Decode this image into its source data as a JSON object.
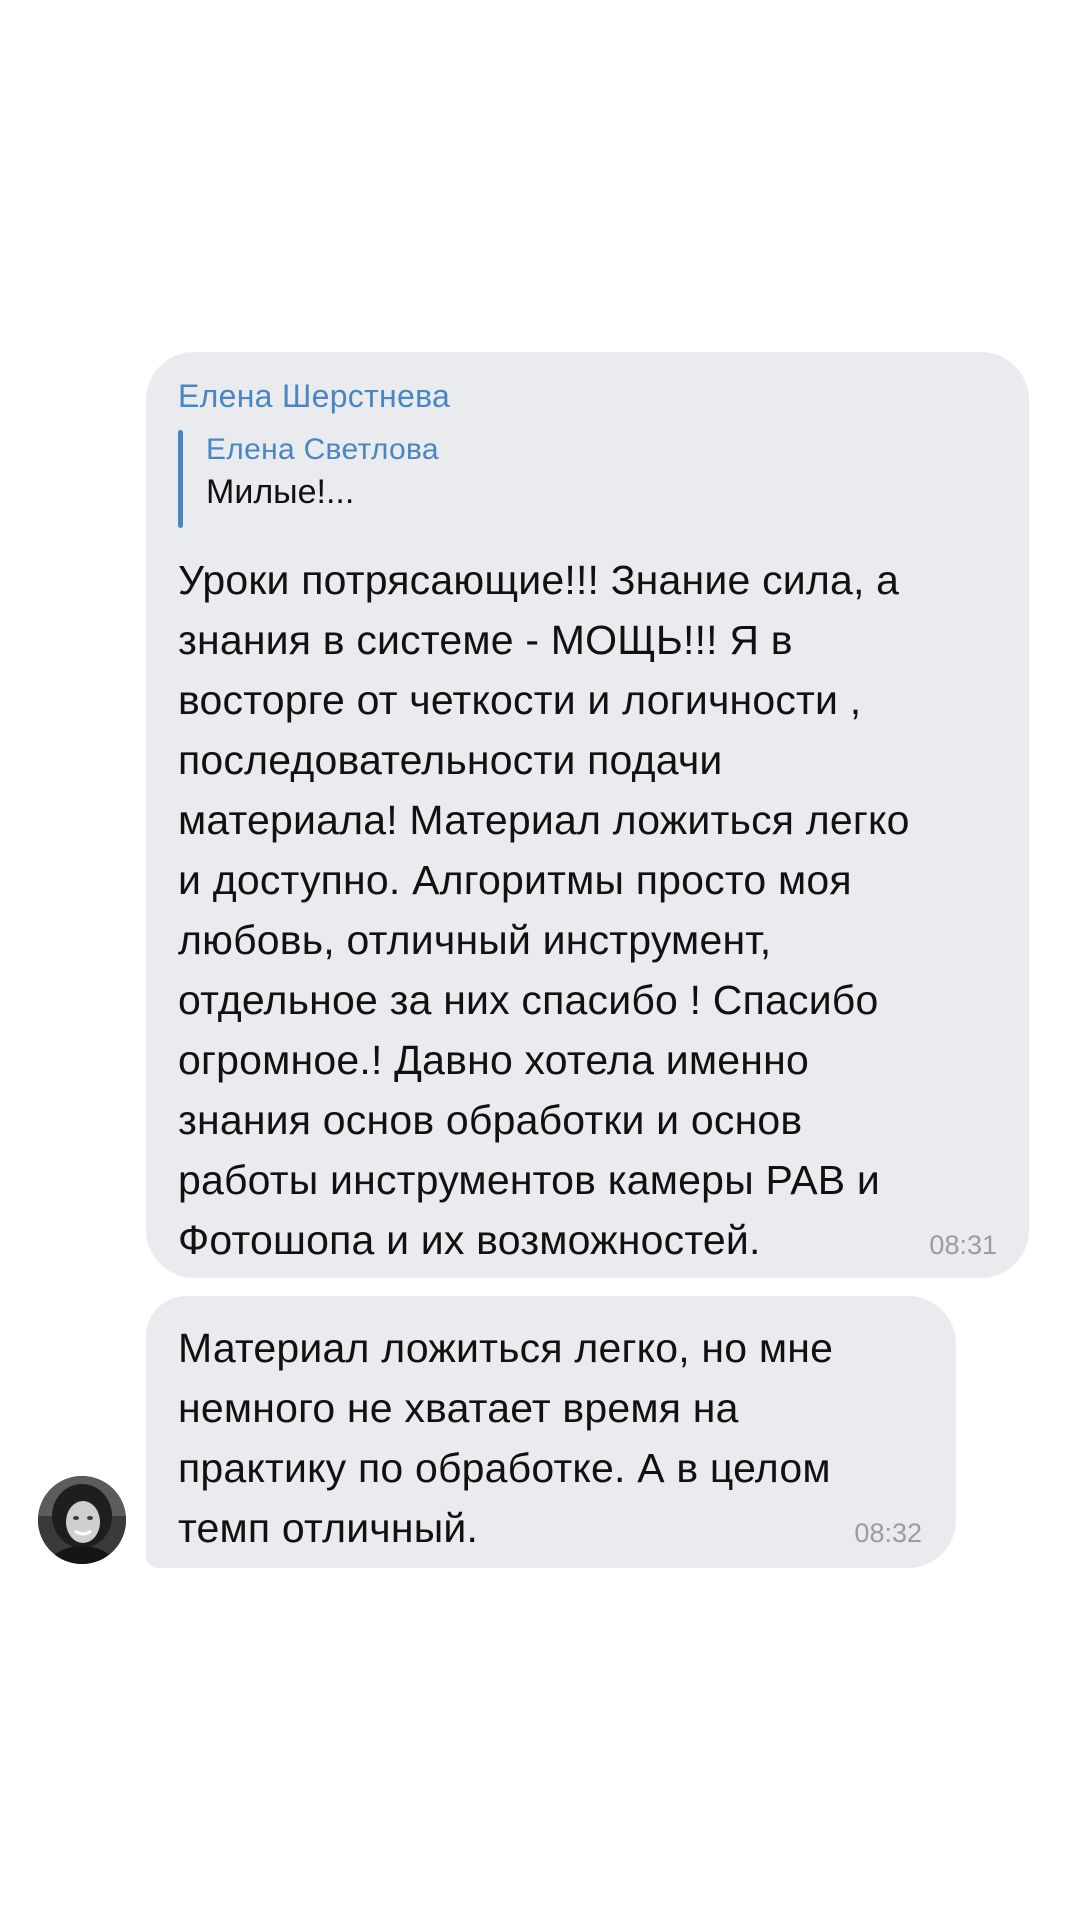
{
  "messages": [
    {
      "sender": "Елена Шерстнева",
      "reply": {
        "name": "Елена Светлова",
        "text": "Милые!..."
      },
      "text": "Уроки потрясающие!!! Знание сила, а\nзнания в системе - МОЩЬ!!! Я в\nвосторге от четкости и логичности ,\nпоследовательности подачи\nматериала! Материал ложиться легко\nи доступно. Алгоритмы просто моя\nлюбовь, отличный инструмент,\nотдельное за них спасибо ! Спасибо\nогромное.! Давно хотела именно\nзнания основ обработки и основ\nработы инструментов камеры РАВ и\nФотошопа и их возможностей.",
      "time": "08:31"
    },
    {
      "text": "Материал ложиться легко, но мне\nнемного не хватает время на\nпрактику по обработке. А в целом\nтемп отличный.",
      "time": "08:32"
    }
  ],
  "avatar": {
    "icon": "user-photo-avatar"
  },
  "colors": {
    "background": "#ffffff",
    "bubble": "#eaebef",
    "accent": "#4a86c4",
    "text": "#111111",
    "timestamp": "#9a9ca2"
  }
}
